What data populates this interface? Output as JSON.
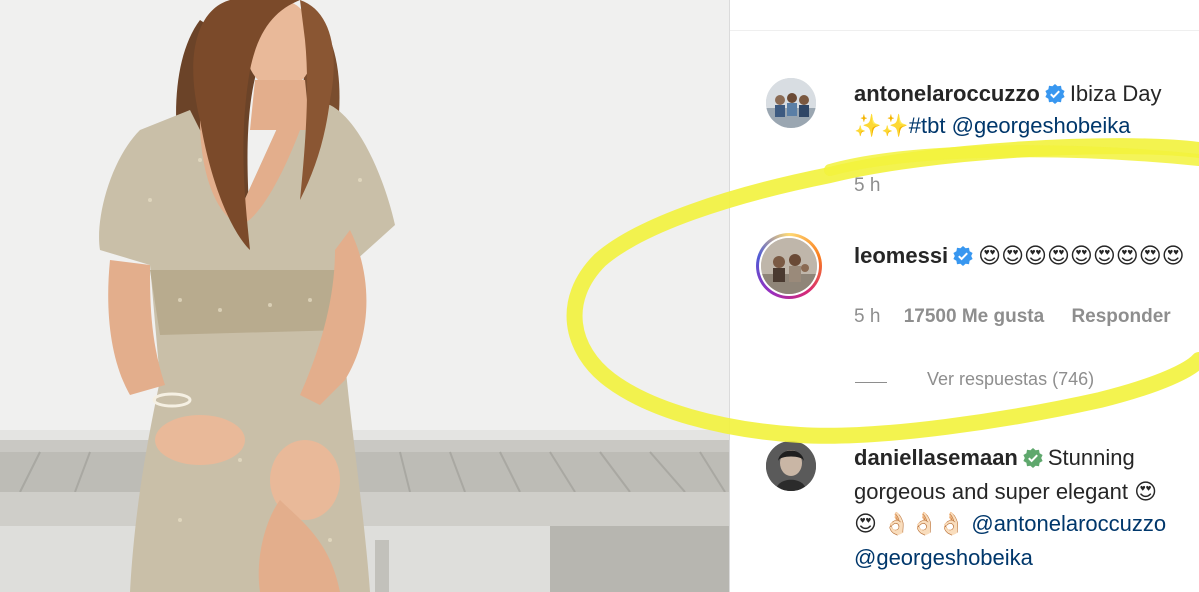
{
  "post": {
    "caption": {
      "username": "antonelaroccuzzo",
      "text_line1": "Ibiza Day",
      "emoji_prefix": "✨✨",
      "hashtag": "#tbt",
      "mention": "@georgeshobeika",
      "time": "5 h"
    }
  },
  "comments": [
    {
      "username": "leomessi",
      "text": "😍😍😍😍😍😍😍😍😍",
      "time": "5 h",
      "likes": "17500 Me gusta",
      "reply_label": "Responder",
      "view_replies": "Ver respuestas (746)"
    },
    {
      "username": "daniellasemaan",
      "text_line1": "Stunning",
      "text_line2": "gorgeous and super elegant 😍",
      "text_line3_emoji": "😍 👌🏻👌🏻👌🏻",
      "mention1": "@antonelaroccuzzo",
      "mention2": "@georgeshobeika"
    }
  ],
  "colors": {
    "verified": "#3897f0",
    "highlight": "#f2f23c",
    "meta_gray": "#8e8e8e",
    "text": "#262626",
    "link": "#00376b"
  }
}
